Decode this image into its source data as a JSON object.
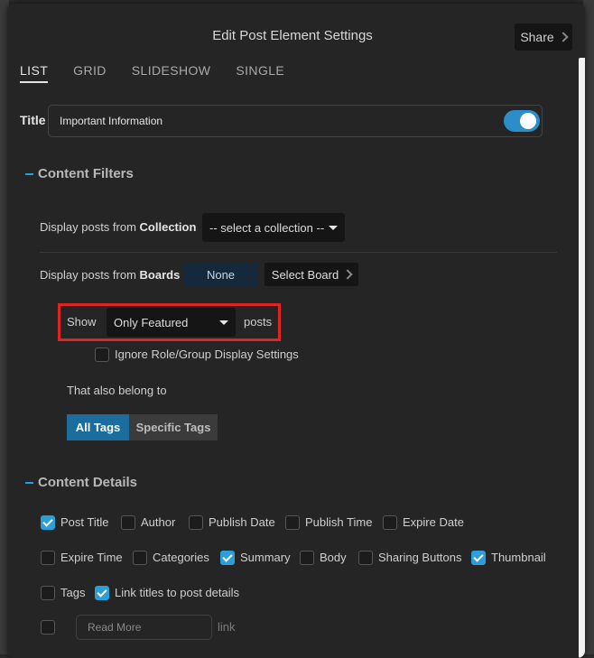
{
  "header": {
    "title": "Edit Post Element Settings",
    "share_label": "Share"
  },
  "tabs": [
    {
      "label": "LIST",
      "active": true
    },
    {
      "label": "GRID",
      "active": false
    },
    {
      "label": "SLIDESHOW",
      "active": false
    },
    {
      "label": "SINGLE",
      "active": false
    }
  ],
  "title_field": {
    "label": "Title",
    "value": "Important Information",
    "toggle_on": true
  },
  "content_filters": {
    "heading": "Content Filters",
    "collection_prefix": "Display posts from ",
    "collection_bold": "Collection",
    "collection_select": "-- select a collection --",
    "boards_prefix": "Display posts from ",
    "boards_bold": "Boards",
    "boards_none": "None",
    "select_board": "Select Board",
    "show_label": "Show",
    "show_select": "Only Featured",
    "posts_label": "posts",
    "ignore_role_label": "Ignore Role/Group Display Settings",
    "also_belong": "That also belong to",
    "all_tags": "All Tags",
    "specific_tags": "Specific Tags"
  },
  "content_details": {
    "heading": "Content Details",
    "options": [
      {
        "label": "Post Title",
        "checked": true
      },
      {
        "label": "Author",
        "checked": false
      },
      {
        "label": "Publish Date",
        "checked": false
      },
      {
        "label": "Publish Time",
        "checked": false
      },
      {
        "label": "Expire Date",
        "checked": false
      },
      {
        "label": "Expire Time",
        "checked": false
      },
      {
        "label": "Categories",
        "checked": false
      },
      {
        "label": "Summary",
        "checked": true
      },
      {
        "label": "Body",
        "checked": false
      },
      {
        "label": "Sharing Buttons",
        "checked": false
      },
      {
        "label": "Thumbnail",
        "checked": true
      },
      {
        "label": "Tags",
        "checked": false
      },
      {
        "label": "Link titles to post details",
        "checked": true
      }
    ],
    "readmore_placeholder": "Read More",
    "link_label": "link"
  },
  "colors": {
    "accent": "#2b9fd8",
    "highlight": "#e02424",
    "toggle": "#2c8ec8",
    "all_tags_bg": "#1a6d9c"
  }
}
